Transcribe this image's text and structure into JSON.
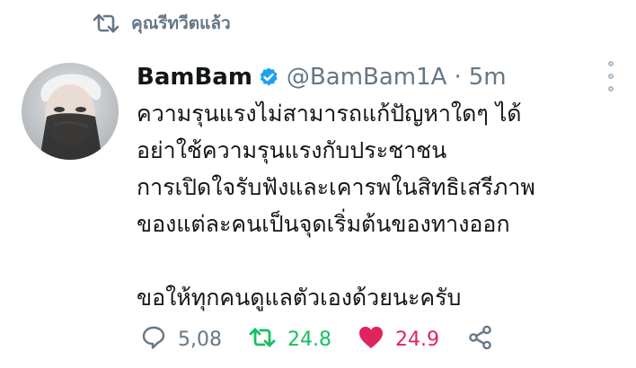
{
  "retweet_context": {
    "label": "คุณรีทวีตแล้ว",
    "icon": "retweet-icon",
    "color": "#657786"
  },
  "author": {
    "display_name": "BamBam",
    "handle": "@BamBam1A",
    "separator": "·",
    "time": "5m",
    "verified": true,
    "verified_color": "#1da1f2",
    "avatar": "avatar-photo"
  },
  "tweet": {
    "lines": [
      "ความรุนแรงไม่สามารถแก้ปัญหาใดๆ ได้",
      "อย่าใช้ความรุนแรงกับประชาชน",
      "การเปิดใจรับฟังและเคารพในสิทธิเสรีภาพ",
      "ของแต่ละคนเป็นจุดเริ่มต้นของทางออก",
      "",
      "ขอให้ทุกคนดูแลตัวเองด้วยนะครับ"
    ]
  },
  "actions": {
    "reply": {
      "icon": "reply-icon",
      "count": "5,08"
    },
    "retweet": {
      "icon": "retweet-icon",
      "count": "24.8",
      "color": "#17bf63"
    },
    "like": {
      "icon": "heart-icon",
      "count": "24.9",
      "color": "#e0245e"
    },
    "share": {
      "icon": "share-icon"
    }
  },
  "colors": {
    "text": "#14171a",
    "muted": "#657786",
    "accent": "#1da1f2"
  }
}
